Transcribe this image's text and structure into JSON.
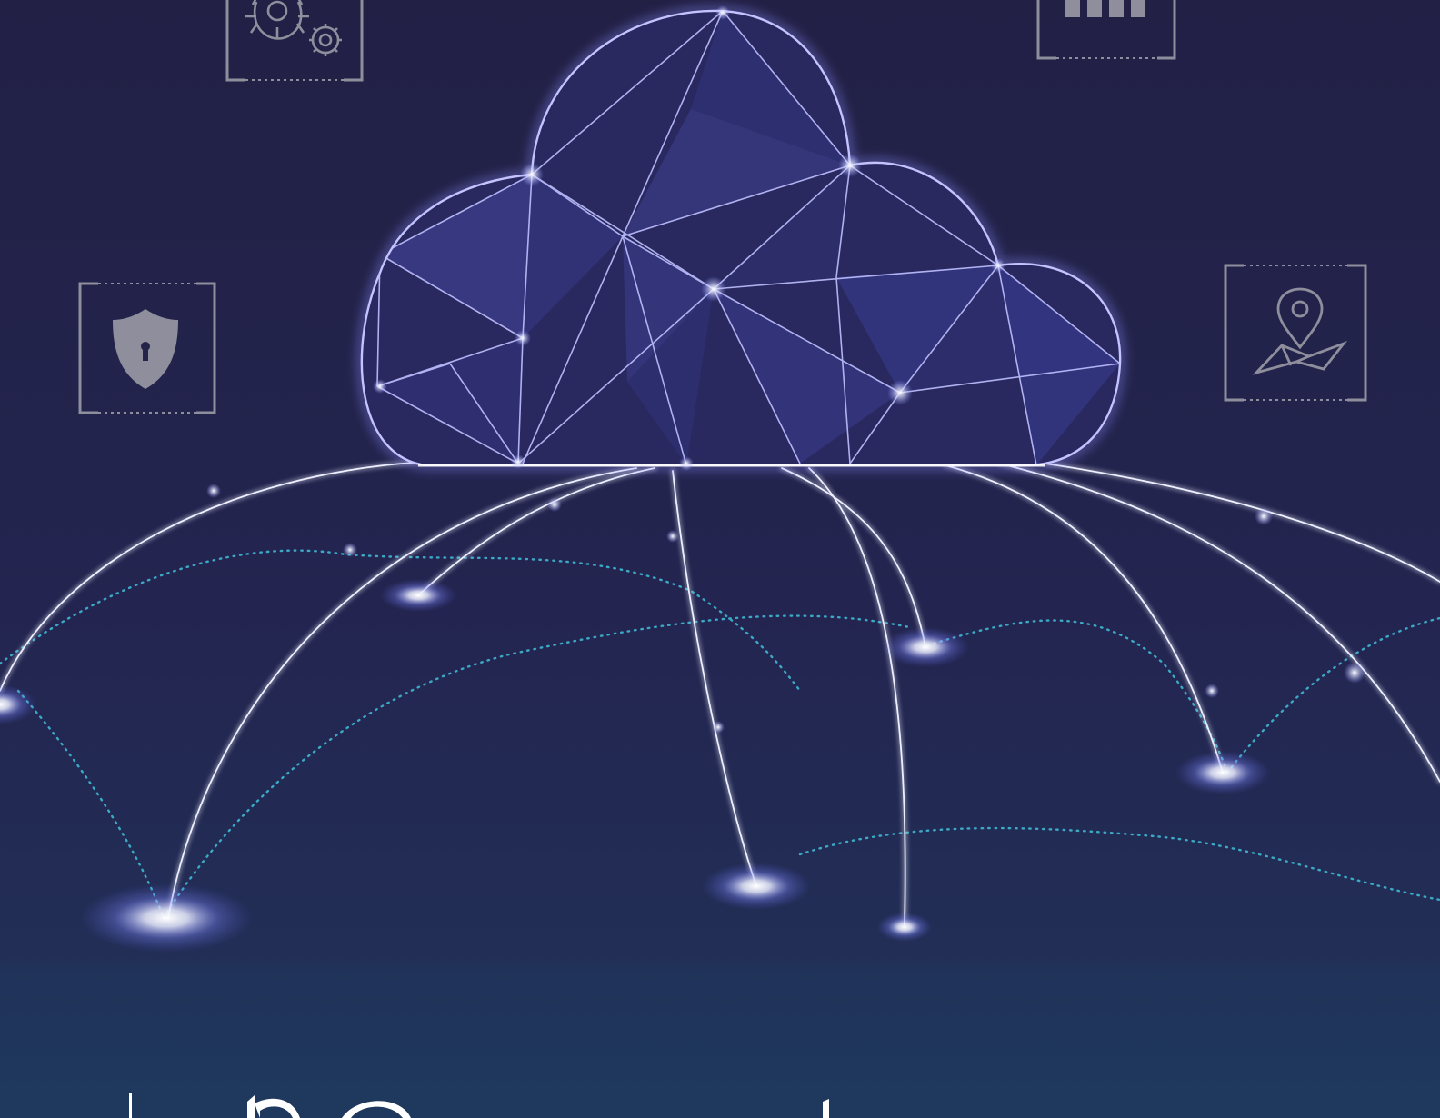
{
  "scene": {
    "kind": "cloud-network-illustration",
    "colors": {
      "background_top": "#222045",
      "background_mid": "#232550",
      "background_bottom": "#1f3a5e",
      "cloud_fill": "#2b2c66",
      "cloud_outline": "#a9a8f0",
      "arc": "#e8e8ff",
      "dotted_route": "#3fb7d2",
      "world_dots": "#4a55a8",
      "icon_gray": "#8e8e9c",
      "glow": "#ffffff"
    },
    "icons": [
      {
        "name": "gears-icon"
      },
      {
        "name": "bar-chart-icon"
      },
      {
        "name": "shield-lock-icon"
      },
      {
        "name": "map-pin-icon"
      }
    ]
  }
}
